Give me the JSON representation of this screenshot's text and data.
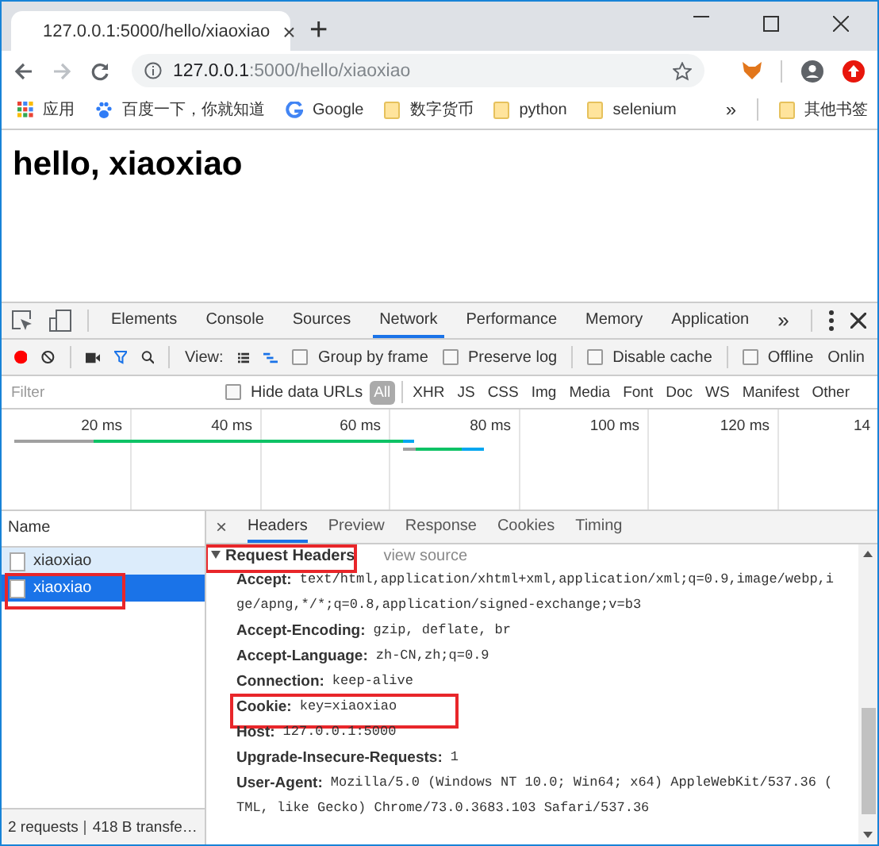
{
  "browser_tab": {
    "title": "127.0.0.1:5000/hello/xiaoxiao",
    "close": "×"
  },
  "new_tab": "+",
  "navigation": {
    "forward_disabled": true
  },
  "address_bar": {
    "host": "127.0.0.1",
    "path": ":5000/hello/xiaoxiao"
  },
  "bookmarks": [
    {
      "kind": "apps",
      "label": "应用"
    },
    {
      "kind": "paw",
      "label": "百度一下，你就知道"
    },
    {
      "kind": "google",
      "label": "Google"
    },
    {
      "kind": "folder",
      "label": "数字货币"
    },
    {
      "kind": "folder",
      "label": "python"
    },
    {
      "kind": "folder",
      "label": "selenium"
    }
  ],
  "bookmarks_overflow": "»",
  "other_bookmarks": "其他书签",
  "page_heading": "hello, xiaoxiao",
  "devtools": {
    "panels": [
      {
        "label": "Elements",
        "selected": false
      },
      {
        "label": "Console",
        "selected": false
      },
      {
        "label": "Sources",
        "selected": false
      },
      {
        "label": "Network",
        "selected": true
      },
      {
        "label": "Performance",
        "selected": false
      },
      {
        "label": "Memory",
        "selected": false
      },
      {
        "label": "Application",
        "selected": false
      }
    ],
    "more_panels": "»",
    "toolbar": {
      "recording": true,
      "filter_on": true,
      "view_label": "View:",
      "waterfall_view": true,
      "options": [
        {
          "label": "Group by frame",
          "checked": false
        },
        {
          "label": "Preserve log",
          "checked": false
        },
        {
          "label": "Disable cache",
          "checked": false
        },
        {
          "label": "Offline",
          "checked": false
        }
      ],
      "throttling": "Onlin"
    },
    "filter": {
      "placeholder": "Filter",
      "hide_data_urls": {
        "label": "Hide data URLs",
        "checked": false
      },
      "types": [
        {
          "label": "All",
          "selected": true
        },
        {
          "label": "XHR",
          "selected": false
        },
        {
          "label": "JS",
          "selected": false
        },
        {
          "label": "CSS",
          "selected": false
        },
        {
          "label": "Img",
          "selected": false
        },
        {
          "label": "Media",
          "selected": false
        },
        {
          "label": "Font",
          "selected": false
        },
        {
          "label": "Doc",
          "selected": false
        },
        {
          "label": "WS",
          "selected": false
        },
        {
          "label": "Manifest",
          "selected": false
        },
        {
          "label": "Other",
          "selected": false
        }
      ]
    },
    "timeline": {
      "ticks": [
        "20 ms",
        "40 ms",
        "60 ms",
        "80 ms",
        "100 ms",
        "120 ms",
        "14"
      ]
    },
    "requests": {
      "column": "Name",
      "rows": [
        {
          "name": "xiaoxiao",
          "selected": false,
          "highlighted": false
        },
        {
          "name": "xiaoxiao",
          "selected": true,
          "highlighted": true
        }
      ],
      "summary": "2 requests",
      "transferred": "418 B transfe…"
    },
    "detail": {
      "close": "×",
      "tabs": [
        {
          "label": "Headers",
          "selected": true
        },
        {
          "label": "Preview",
          "selected": false
        },
        {
          "label": "Response",
          "selected": false
        },
        {
          "label": "Cookies",
          "selected": false
        },
        {
          "label": "Timing",
          "selected": false
        }
      ],
      "section": {
        "title": "Request Headers",
        "expanded": true,
        "highlighted": true,
        "view_source": "view source"
      },
      "headers": [
        {
          "name": "Accept:",
          "value_lines": [
            "text/html,application/xhtml+xml,application/xml;q=0.9,image/webp,i",
            "ge/apng,*/*;q=0.8,application/signed-exchange;v=b3"
          ],
          "highlighted": false
        },
        {
          "name": "Accept-Encoding:",
          "value_lines": [
            "gzip, deflate, br"
          ],
          "highlighted": false
        },
        {
          "name": "Accept-Language:",
          "value_lines": [
            "zh-CN,zh;q=0.9"
          ],
          "highlighted": false
        },
        {
          "name": "Connection:",
          "value_lines": [
            "keep-alive"
          ],
          "highlighted": false
        },
        {
          "name": "Cookie:",
          "value_lines": [
            "key=xiaoxiao"
          ],
          "highlighted": true
        },
        {
          "name": "Host:",
          "value_lines": [
            "127.0.0.1:5000"
          ],
          "highlighted": false
        },
        {
          "name": "Upgrade-Insecure-Requests:",
          "value_lines": [
            "1"
          ],
          "highlighted": false
        },
        {
          "name": "User-Agent:",
          "value_lines": [
            "Mozilla/5.0 (Windows NT 10.0; Win64; x64) AppleWebKit/537.36 (",
            "TML, like Gecko) Chrome/73.0.3683.103 Safari/537.36"
          ],
          "highlighted": false
        }
      ]
    }
  }
}
